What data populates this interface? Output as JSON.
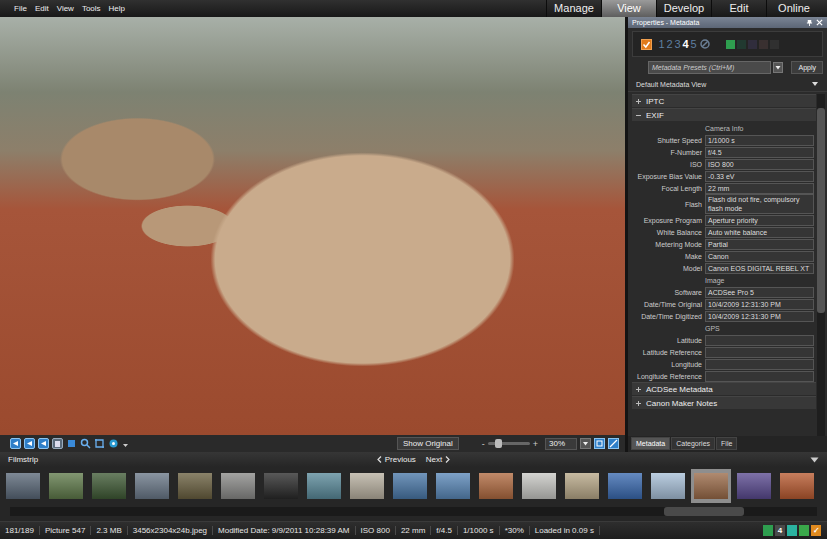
{
  "menu": [
    "File",
    "Edit",
    "View",
    "Tools",
    "Help"
  ],
  "modes": [
    {
      "label": "Manage",
      "selected": false
    },
    {
      "label": "View",
      "selected": true
    },
    {
      "label": "Develop",
      "selected": false
    },
    {
      "label": "Edit",
      "selected": false
    },
    {
      "label": "Online",
      "selected": false
    }
  ],
  "toolbar": {
    "show_original": "Show Original",
    "zoom_out": "-",
    "zoom_in": "+",
    "zoom_level": 0.2,
    "zoom": "30%"
  },
  "properties": {
    "title": "Properties - Metadata",
    "tagged": true,
    "ratings": [
      {
        "label": "1",
        "selected": false
      },
      {
        "label": "2",
        "selected": false
      },
      {
        "label": "3",
        "selected": false
      },
      {
        "label": "4",
        "selected": true
      },
      {
        "label": "5",
        "selected": false
      }
    ],
    "color_labels": [
      {
        "color": "#2e9e4f",
        "selected": true
      },
      {
        "color": "#1f4a3a",
        "selected": false
      },
      {
        "color": "#3a3550",
        "selected": false
      },
      {
        "color": "#4a3a3a",
        "selected": false
      },
      {
        "color": "#3a3a3a",
        "selected": false
      }
    ],
    "presets": {
      "placeholder": "Metadata Presets (Ctrl+M)"
    },
    "apply": "Apply",
    "view": "Default Metadata View",
    "sections": [
      {
        "label": "IPTC",
        "expanded": false,
        "rows": []
      },
      {
        "label": "EXIF",
        "expanded": true,
        "rows": [
          {
            "kind": "heading",
            "label": "Camera Info",
            "value": ""
          },
          {
            "kind": "field",
            "label": "Shutter Speed",
            "value": "1/1000 s"
          },
          {
            "kind": "field",
            "label": "F-Number",
            "value": "f/4.5"
          },
          {
            "kind": "field",
            "label": "ISO",
            "value": "ISO 800"
          },
          {
            "kind": "field",
            "label": "Exposure Bias Value",
            "value": "-0.33 eV"
          },
          {
            "kind": "field",
            "label": "Focal Length",
            "value": "22 mm"
          },
          {
            "kind": "field",
            "label": "Flash",
            "value": "Flash did not fire, compulsory flash mode"
          },
          {
            "kind": "field",
            "label": "Exposure Program",
            "value": "Aperture priority"
          },
          {
            "kind": "field",
            "label": "White Balance",
            "value": "Auto white balance"
          },
          {
            "kind": "field",
            "label": "Metering Mode",
            "value": "Partial"
          },
          {
            "kind": "field",
            "label": "Make",
            "value": "Canon"
          },
          {
            "kind": "field",
            "label": "Model",
            "value": "Canon EOS DIGITAL REBEL XT"
          },
          {
            "kind": "heading",
            "label": "Image",
            "value": ""
          },
          {
            "kind": "field",
            "label": "Software",
            "value": "ACDSee Pro 5"
          },
          {
            "kind": "field",
            "label": "Date/Time Original",
            "value": "10/4/2009 12:31:30 PM"
          },
          {
            "kind": "field",
            "label": "Date/Time Digitized",
            "value": "10/4/2009 12:31:30 PM"
          },
          {
            "kind": "heading",
            "label": "GPS",
            "value": ""
          },
          {
            "kind": "field",
            "label": "Latitude",
            "value": ""
          },
          {
            "kind": "field",
            "label": "Latitude Reference",
            "value": ""
          },
          {
            "kind": "field",
            "label": "Longitude",
            "value": ""
          },
          {
            "kind": "field",
            "label": "Longitude Reference",
            "value": ""
          }
        ]
      },
      {
        "label": "ACDSee Metadata",
        "expanded": false,
        "rows": []
      },
      {
        "label": "Canon Maker Notes",
        "expanded": false,
        "rows": []
      }
    ],
    "tabs": [
      {
        "label": "Metadata",
        "selected": true
      },
      {
        "label": "Categories",
        "selected": false
      },
      {
        "label": "File",
        "selected": false
      }
    ]
  },
  "filmstrip": {
    "title": "Filmstrip",
    "previous": "Previous",
    "next": "Next",
    "scroll_level": 0.9,
    "thumbnails": [
      {
        "color": "#5a6878",
        "selected": false
      },
      {
        "color": "#5f7a4a",
        "selected": false
      },
      {
        "color": "#3f5a35",
        "selected": false
      },
      {
        "color": "#6a7888",
        "selected": false
      },
      {
        "color": "#6a6040",
        "selected": false
      },
      {
        "color": "#8a8a88",
        "selected": false
      },
      {
        "color": "#2a2a2a",
        "selected": false
      },
      {
        "color": "#5a8a9a",
        "selected": false
      },
      {
        "color": "#b8b0a0",
        "selected": false
      },
      {
        "color": "#4a78a8",
        "selected": false
      },
      {
        "color": "#5a88b8",
        "selected": false
      },
      {
        "color": "#b06a40",
        "selected": false
      },
      {
        "color": "#c8c8c4",
        "selected": false
      },
      {
        "color": "#b8a888",
        "selected": false
      },
      {
        "color": "#3a6ab0",
        "selected": false
      },
      {
        "color": "#a8c0d8",
        "selected": false
      },
      {
        "color": "#9a6a48",
        "selected": true
      },
      {
        "color": "#5a4a90",
        "selected": false
      },
      {
        "color": "#b85a30",
        "selected": false
      }
    ]
  },
  "status_bar": {
    "items": [
      "181/189",
      "Picture 547",
      "2.3 MB",
      "3456x2304x24b.jpeg",
      "Modified Date: 9/9/2011 10:28:39 AM",
      "ISO 800",
      "22 mm",
      "f/4.5",
      "1/1000 s",
      "*30%",
      "Loaded in 0.09 s"
    ],
    "badges": [
      {
        "label": "",
        "color": "#2e9e4f"
      },
      {
        "label": "4",
        "color": "#4a4a4a"
      },
      {
        "label": "",
        "color": "#2bb3a0"
      },
      {
        "label": "",
        "color": "#3aa84a"
      },
      {
        "label": "✓",
        "color": "#e08a1e"
      }
    ]
  }
}
